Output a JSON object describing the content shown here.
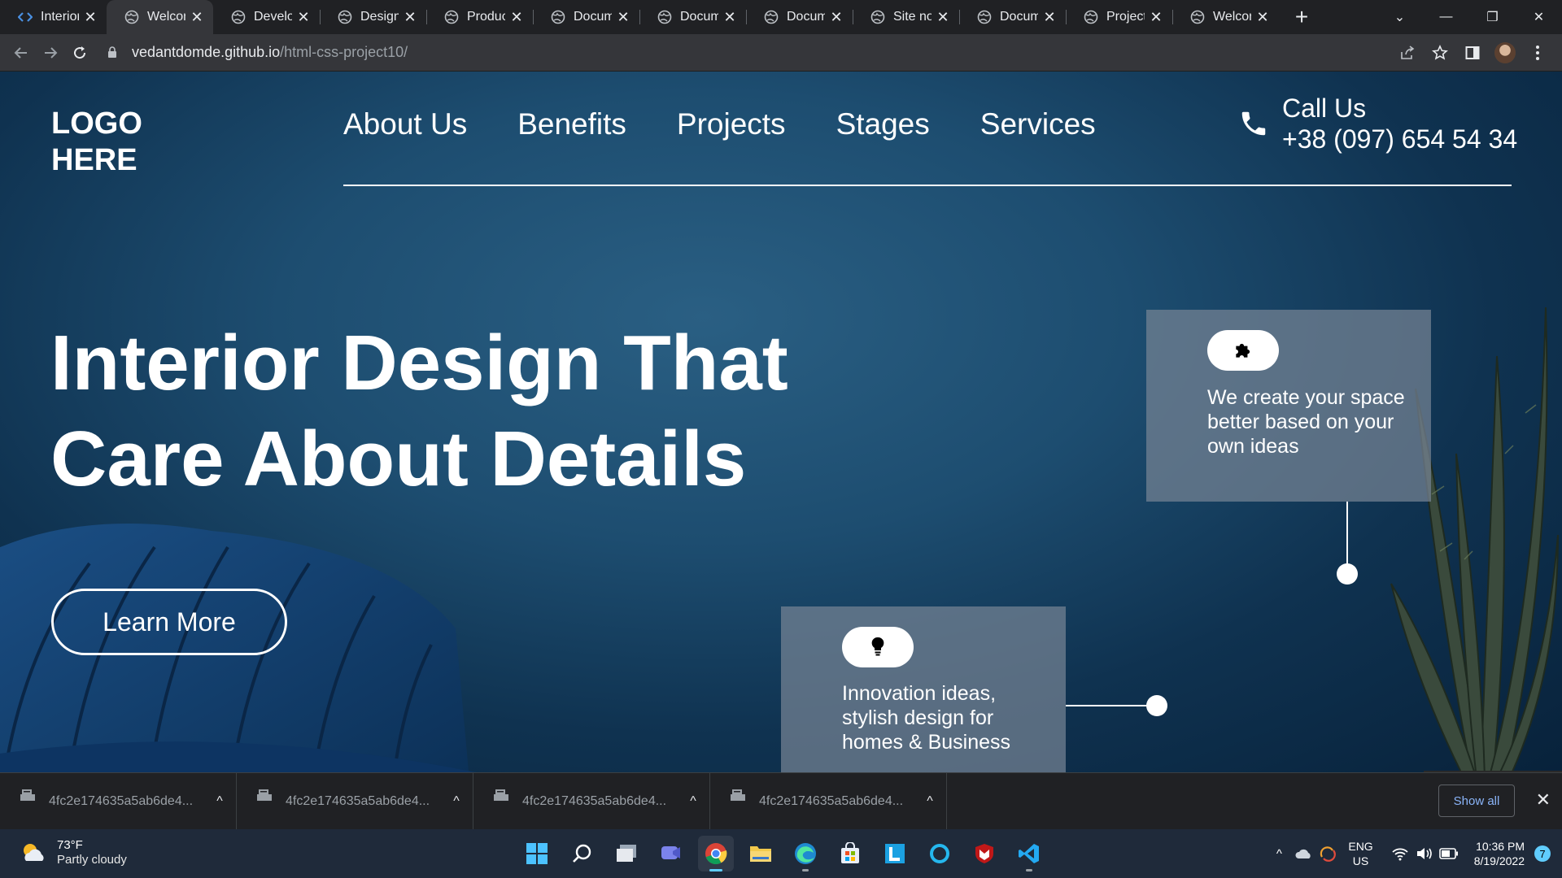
{
  "browser": {
    "tabs": [
      {
        "title": "Interior",
        "active": false
      },
      {
        "title": "Welcom",
        "active": true
      },
      {
        "title": "Develo",
        "active": false
      },
      {
        "title": "Design",
        "active": false
      },
      {
        "title": "Product",
        "active": false
      },
      {
        "title": "Docum",
        "active": false
      },
      {
        "title": "Docum",
        "active": false
      },
      {
        "title": "Docum",
        "active": false
      },
      {
        "title": "Site not",
        "active": false
      },
      {
        "title": "Docum",
        "active": false
      },
      {
        "title": "Project",
        "active": false
      },
      {
        "title": "Welcom",
        "active": false
      }
    ],
    "url_host": "vedantdomde.github.io",
    "url_path": "/html-css-project10/"
  },
  "site": {
    "logo_line1": "LOGO",
    "logo_line2": "HERE",
    "nav": [
      "About Us",
      "Benefits",
      "Projects",
      "Stages",
      "Services"
    ],
    "call_label": "Call Us",
    "phone": "+38 (097) 654 54 34",
    "hero_line1": "Interior Design That",
    "hero_line2": "Care About Details",
    "cta_label": "Learn More",
    "card1_text": "We create your space better based on your own ideas",
    "card2_text": "Innovation ideas, stylish design for homes & Business"
  },
  "downloads": {
    "items": [
      "4fc2e174635a5ab6de4...",
      "4fc2e174635a5ab6de4...",
      "4fc2e174635a5ab6de4...",
      "4fc2e174635a5ab6de4..."
    ],
    "show_all": "Show all"
  },
  "taskbar": {
    "temp": "73°F",
    "weather": "Partly cloudy",
    "lang1": "ENG",
    "lang2": "US",
    "time": "10:36 PM",
    "date": "8/19/2022",
    "notifications": "7"
  },
  "colors": {
    "page_bg": "#1d4d70",
    "card_bg": "#76849a",
    "tab_strip": "#202124",
    "toolbar": "#35363a",
    "taskbar": "#1f2a3a",
    "accent": "#60cdff"
  }
}
